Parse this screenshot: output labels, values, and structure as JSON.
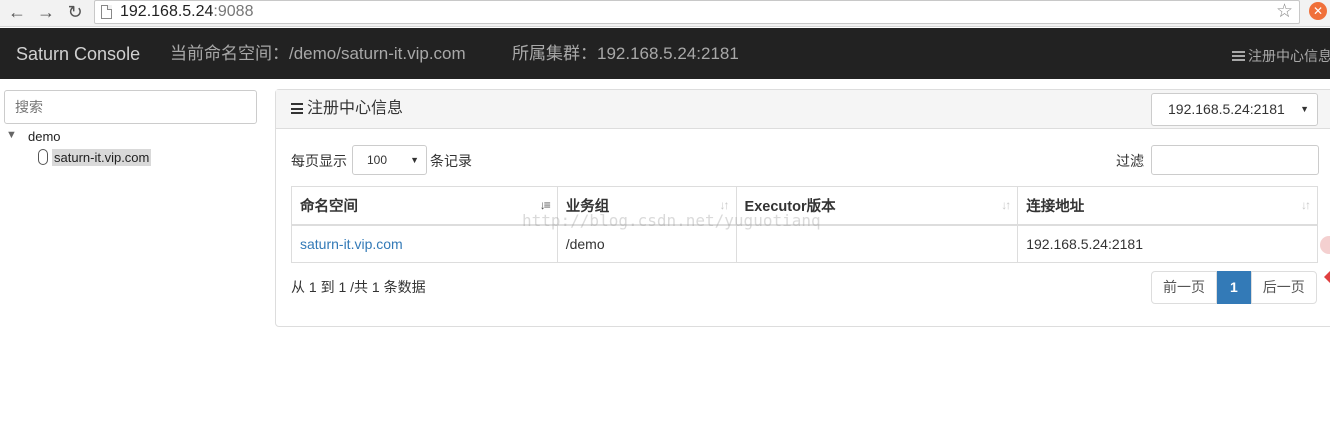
{
  "browser": {
    "url_host": "192.168.5.24",
    "url_port": ":9088"
  },
  "navbar": {
    "brand": "Saturn Console",
    "namespace_label": "当前命名空间：",
    "namespace_value": "/demo/saturn-it.vip.com",
    "cluster_label": "所属集群：",
    "cluster_value": "192.168.5.24:2181",
    "right_link": "注册中心信息"
  },
  "sidebar": {
    "search_placeholder": "搜索",
    "tree": {
      "root": "demo",
      "children": [
        "saturn-it.vip.com"
      ]
    }
  },
  "panel": {
    "title": "注册中心信息",
    "zk_selected": "192.168.5.24:2181",
    "length_prefix": "每页显示",
    "length_value": "100",
    "length_suffix": "条记录",
    "filter_label": "过滤",
    "columns": [
      "命名空间",
      "业务组",
      "Executor版本",
      "连接地址"
    ],
    "rows": [
      [
        "saturn-it.vip.com",
        "/demo",
        "",
        "192.168.5.24:2181"
      ]
    ],
    "info": "从 1 到 1 /共 1 条数据",
    "pager": {
      "prev": "前一页",
      "current": "1",
      "next": "后一页"
    }
  },
  "watermark": "http://blog.csdn.net/yuguotianq",
  "colors": {
    "navbar_bg": "#222222",
    "link": "#337ab7",
    "pager_active": "#337ab7"
  }
}
